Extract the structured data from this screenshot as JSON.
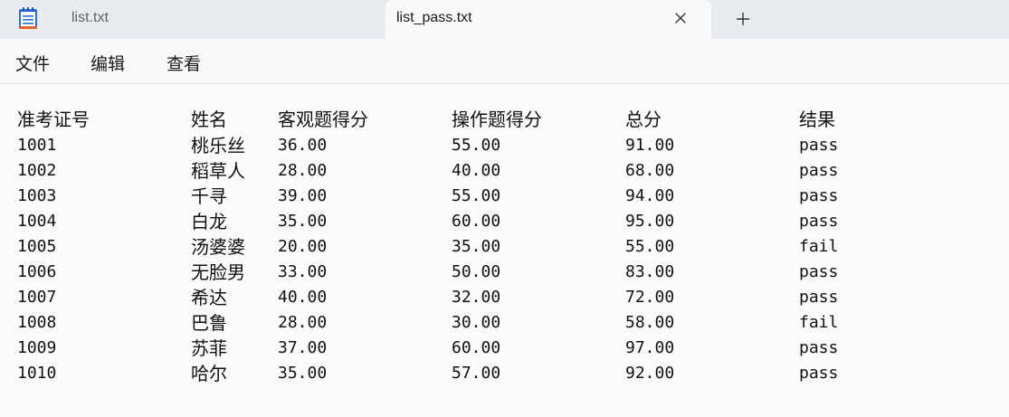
{
  "tabs": [
    {
      "label": "list.txt",
      "active": false
    },
    {
      "label": "list_pass.txt",
      "active": true
    }
  ],
  "icons": {
    "app": "notepad-icon",
    "close": "close-icon",
    "new_tab": "plus-icon"
  },
  "menu": [
    "文件",
    "编辑",
    "查看"
  ],
  "content": {
    "headers": [
      "准考证号",
      "姓名",
      "客观题得分",
      "操作题得分",
      "总分",
      "结果"
    ],
    "rows": [
      [
        "1001",
        "桃乐丝",
        "36.00",
        "55.00",
        "91.00",
        "pass"
      ],
      [
        "1002",
        "稻草人",
        "28.00",
        "40.00",
        "68.00",
        "pass"
      ],
      [
        "1003",
        "千寻",
        "39.00",
        "55.00",
        "94.00",
        "pass"
      ],
      [
        "1004",
        "白龙",
        "35.00",
        "60.00",
        "95.00",
        "pass"
      ],
      [
        "1005",
        "汤婆婆",
        "20.00",
        "35.00",
        "55.00",
        "fail"
      ],
      [
        "1006",
        "无脸男",
        "33.00",
        "50.00",
        "83.00",
        "pass"
      ],
      [
        "1007",
        "希达",
        "40.00",
        "32.00",
        "72.00",
        "pass"
      ],
      [
        "1008",
        "巴鲁",
        "28.00",
        "30.00",
        "58.00",
        "fail"
      ],
      [
        "1009",
        "苏菲",
        "37.00",
        "60.00",
        "97.00",
        "pass"
      ],
      [
        "1010",
        "哈尔",
        "35.00",
        "57.00",
        "92.00",
        "pass"
      ]
    ]
  },
  "colors": {
    "tabbar": "#e8ecf1",
    "active_tab": "#f9f9f9",
    "text": "#111111",
    "icon_blue": "#2b6fd6"
  }
}
